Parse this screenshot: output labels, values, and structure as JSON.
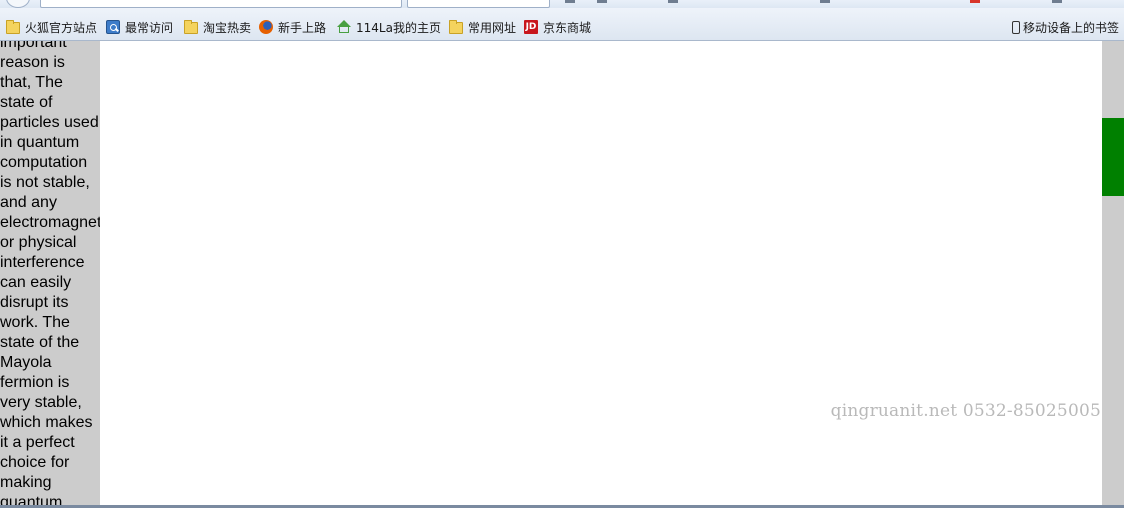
{
  "bookmarks": {
    "items": [
      {
        "label": "火狐官方站点",
        "icon": "folder-icon"
      },
      {
        "label": "最常访问",
        "icon": "history-icon"
      },
      {
        "label": "淘宝热卖",
        "icon": "folder-icon"
      },
      {
        "label": "新手上路",
        "icon": "firefox-icon"
      },
      {
        "label": "114La我的主页",
        "icon": "home-icon"
      },
      {
        "label": "常用网址",
        "icon": "folder-icon"
      },
      {
        "label": "京东商城",
        "icon": "jd-icon",
        "icon_text": "JD"
      }
    ],
    "mobile": {
      "label": "移动设备上的书签",
      "icon": "mobile-icon"
    }
  },
  "page": {
    "article_text": "important reason is that, The state of particles used in quantum computation is not stable, and any electromagnetic or physical interference can easily disrupt its work. The state of the Mayola fermion is very stable, which makes it a perfect choice for making quantum",
    "watermark": "qingruanit.net 0532-85025005"
  },
  "colors": {
    "left_column": "#cccccc",
    "right_column": "#cccccc",
    "green_block": "#008000",
    "watermark": "#b9b9b9"
  }
}
